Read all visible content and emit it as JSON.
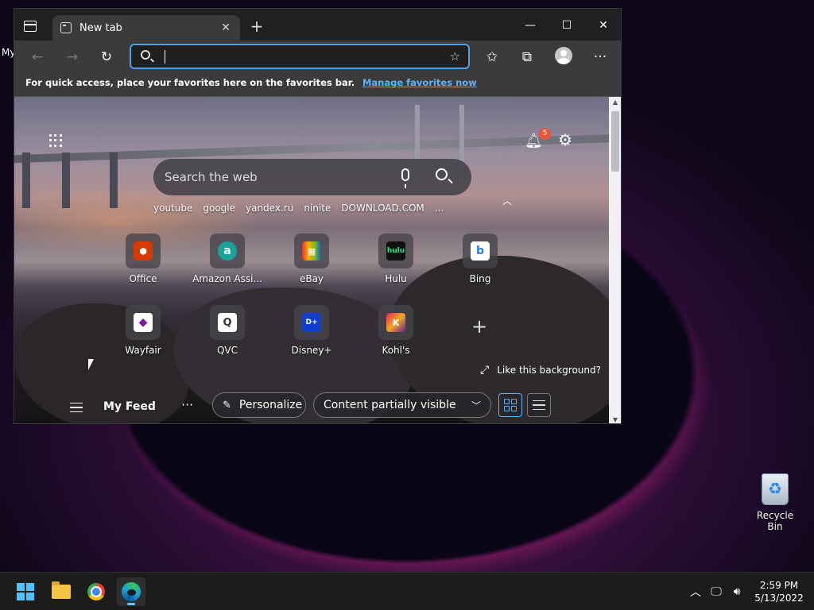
{
  "desktop": {
    "partial_label": "My",
    "recycle_bin_label": "Recycle Bin"
  },
  "browser": {
    "tab_title": "New tab",
    "address": {
      "value": "",
      "placeholder": ""
    },
    "favorites_bar": {
      "message": "For quick access, place your favorites here on the favorites bar.",
      "link": "Manage favorites now"
    }
  },
  "ntp": {
    "notification_count": "5",
    "search_placeholder": "Search the web",
    "quick_links": [
      "youtube",
      "google",
      "yandex.ru",
      "ninite",
      "DOWNLOAD.COM",
      "..."
    ],
    "tiles_row1": [
      {
        "label": "Office",
        "logo": "⬢",
        "color": "#d83b01"
      },
      {
        "label": "Amazon Assi...",
        "logo": "a",
        "color": "#1aa39a"
      },
      {
        "label": "eBay",
        "logo": "▦",
        "color": "#e53238"
      },
      {
        "label": "Hulu",
        "logo": "hulu",
        "color": "#111111"
      },
      {
        "label": "Bing",
        "logo": "b",
        "color": "#2b7de9"
      }
    ],
    "tiles_row2": [
      {
        "label": "Wayfair",
        "logo": "◆",
        "color": "#7b189f"
      },
      {
        "label": "QVC",
        "logo": "Q",
        "color": "#ffffff"
      },
      {
        "label": "Disney+",
        "logo": "D+",
        "color": "#113ccf"
      },
      {
        "label": "Kohl's",
        "logo": "K",
        "color": "#8a1a5a"
      }
    ],
    "like_background": "Like this background?",
    "feed": {
      "title": "My Feed",
      "more": "···",
      "personalize": "Personalize",
      "visibility": "Content partially visible"
    }
  },
  "taskbar": {
    "clock_time": "2:59 PM",
    "clock_date": "5/13/2022"
  }
}
